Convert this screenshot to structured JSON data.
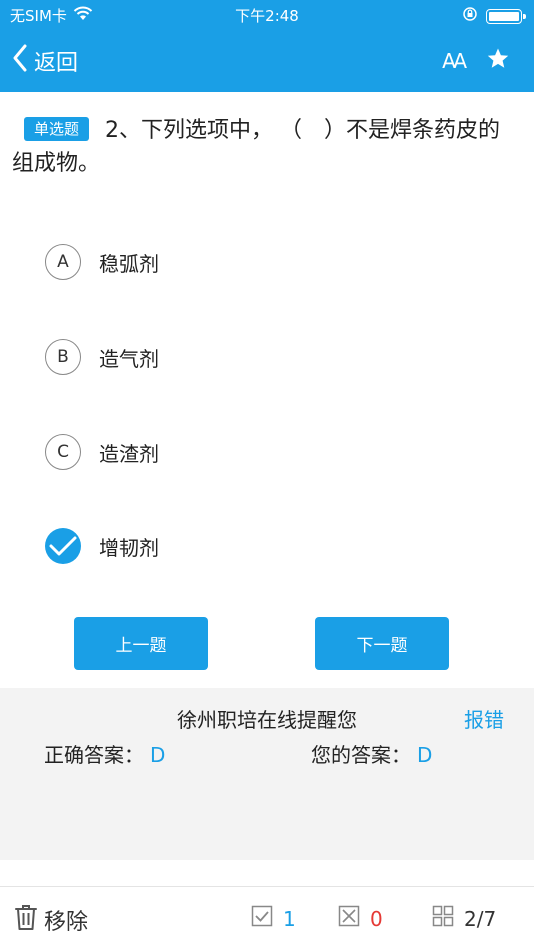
{
  "status_bar": {
    "carrier": "无SIM卡",
    "time": "下午2:48"
  },
  "nav": {
    "back_label": "返回",
    "font_icon_label": "AA"
  },
  "question": {
    "type_badge": "单选题",
    "text": "2、下列选项中， （　）不是焊条药皮的组成物。"
  },
  "options": [
    {
      "letter": "A",
      "text": "稳弧剂",
      "selected": false
    },
    {
      "letter": "B",
      "text": "造气剂",
      "selected": false
    },
    {
      "letter": "C",
      "text": "造渣剂",
      "selected": false
    },
    {
      "letter": "D",
      "text": "增韧剂",
      "selected": true
    }
  ],
  "buttons": {
    "prev": "上一题",
    "next": "下一题"
  },
  "answer_panel": {
    "title": "徐州职培在线提醒您",
    "report": "报错",
    "correct_label": "正确答案：",
    "correct_value": "D",
    "yours_label": "您的答案：",
    "yours_value": "D"
  },
  "bottom_bar": {
    "remove_label": "移除",
    "correct_count": "1",
    "wrong_count": "0",
    "progress": "2/7"
  },
  "colors": {
    "accent": "#1a9fe6",
    "wrong": "#e53935"
  }
}
